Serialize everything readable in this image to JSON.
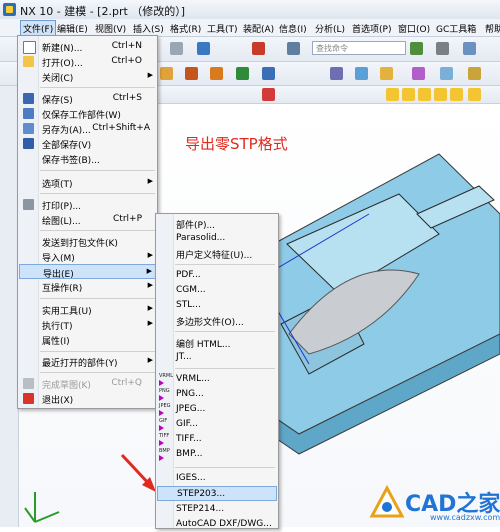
{
  "window": {
    "title": "NX 10 - 建模 - [2.prt （修改的）]"
  },
  "menubar": {
    "items": [
      "文件(F)",
      "编辑(E)",
      "视图(V)",
      "插入(S)",
      "格式(R)",
      "工具(T)",
      "装配(A)",
      "信息(I)",
      "分析(L)",
      "首选项(P)",
      "窗口(O)",
      "GC工具箱",
      "帮助"
    ]
  },
  "toolbar": {
    "search_placeholder": "查找命令"
  },
  "file_menu": {
    "items": [
      {
        "label": "新建(N)...",
        "shortcut": "Ctrl+N"
      },
      {
        "label": "打开(O)...",
        "shortcut": "Ctrl+O"
      },
      {
        "label": "关闭(C)",
        "shortcut": ""
      },
      {
        "label": "保存(S)",
        "shortcut": "Ctrl+S"
      },
      {
        "label": "仅保存工作部件(W)",
        "shortcut": ""
      },
      {
        "label": "另存为(A)...",
        "shortcut": "Ctrl+Shift+A"
      },
      {
        "label": "全部保存(V)",
        "shortcut": ""
      },
      {
        "label": "保存书签(B)...",
        "shortcut": ""
      },
      {
        "label": "选项(T)",
        "shortcut": ""
      },
      {
        "label": "打印(P)...",
        "shortcut": ""
      },
      {
        "label": "绘图(L)...",
        "shortcut": "Ctrl+P"
      },
      {
        "label": "发送到打包文件(K)",
        "shortcut": ""
      },
      {
        "label": "导入(M)",
        "shortcut": ""
      },
      {
        "label": "导出(E)",
        "shortcut": ""
      },
      {
        "label": "互操作(R)",
        "shortcut": ""
      },
      {
        "label": "实用工具(U)",
        "shortcut": ""
      },
      {
        "label": "执行(T)",
        "shortcut": ""
      },
      {
        "label": "属性(I)",
        "shortcut": ""
      },
      {
        "label": "最近打开的部件(Y)",
        "shortcut": ""
      },
      {
        "label": "完成草图(K)",
        "shortcut": "Ctrl+Q"
      },
      {
        "label": "退出(X)",
        "shortcut": ""
      }
    ]
  },
  "export_menu": {
    "items": [
      {
        "label": "部件(P)..."
      },
      {
        "label": "Parasolid..."
      },
      {
        "label": "用户定义特征(U)..."
      },
      {
        "label": "PDF..."
      },
      {
        "label": "CGM..."
      },
      {
        "label": "STL..."
      },
      {
        "label": "多边形文件(O)..."
      },
      {
        "label": "编创 HTML..."
      },
      {
        "label": "JT..."
      },
      {
        "label": "VRML..."
      },
      {
        "label": "PNG..."
      },
      {
        "label": "JPEG..."
      },
      {
        "label": "GIF..."
      },
      {
        "label": "TIFF..."
      },
      {
        "label": "BMP..."
      },
      {
        "label": "IGES..."
      },
      {
        "label": "STEP203..."
      },
      {
        "label": "STEP214..."
      },
      {
        "label": "AutoCAD DXF/DWG..."
      }
    ],
    "icon_tags": [
      "VRML",
      "PNG",
      "JPEG",
      "GIF",
      "TIFF",
      "BMP"
    ]
  },
  "annotation": {
    "text": "导出零STP格式"
  },
  "watermark": {
    "text": "CAD之家",
    "url": "www.cadzxw.com"
  },
  "colors": {
    "annotation": "#e02a20",
    "highlight": "#cde3f9",
    "model": "#8ecbe6",
    "watermark": "#1f74d6"
  }
}
